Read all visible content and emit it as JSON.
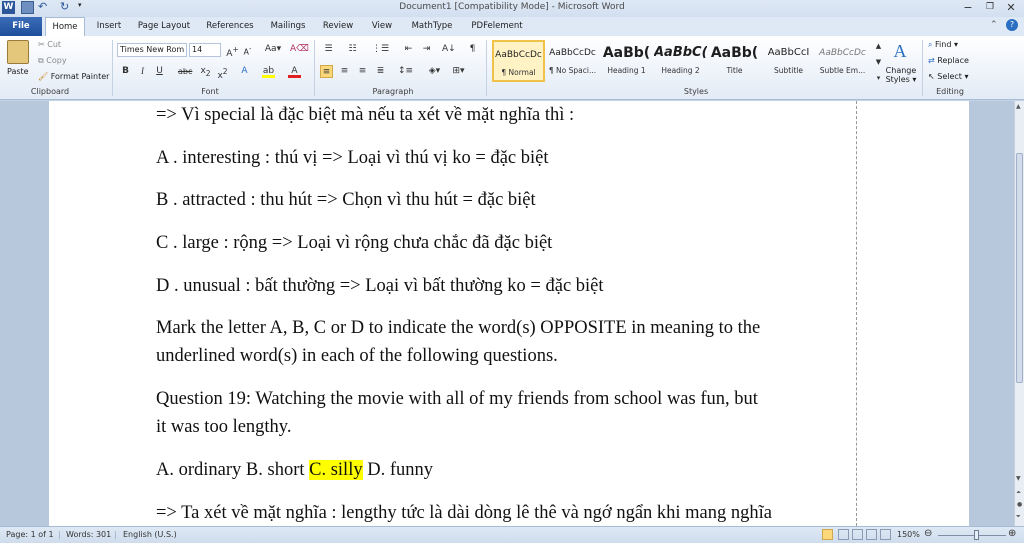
{
  "window": {
    "title": "Document1 [Compatibility Mode] - Microsoft Word",
    "minimize": "−",
    "restore": "❐",
    "close": "✕"
  },
  "tabs": [
    "File",
    "Home",
    "Insert",
    "Page Layout",
    "References",
    "Mailings",
    "Review",
    "View",
    "MathType",
    "PDFelement"
  ],
  "ribbon": {
    "clipboard": {
      "paste": "Paste",
      "cut": "Cut",
      "copy": "Copy",
      "format_painter": "Format Painter",
      "label": "Clipboard"
    },
    "font": {
      "name": "Times New Rom",
      "size": "14",
      "label": "Font"
    },
    "paragraph": {
      "label": "Paragraph"
    },
    "styles": {
      "label": "Styles",
      "items": [
        {
          "preview": "AaBbCcDc",
          "name": "¶ Normal"
        },
        {
          "preview": "AaBbCcDc",
          "name": "¶ No Spaci..."
        },
        {
          "preview": "AaBb(",
          "name": "Heading 1"
        },
        {
          "preview": "AaBbC(",
          "name": "Heading 2"
        },
        {
          "preview": "AaBb(",
          "name": "Title"
        },
        {
          "preview": "AaBbCcI",
          "name": "Subtitle"
        },
        {
          "preview": "AaBbCcDc",
          "name": "Subtle Em..."
        }
      ],
      "change_styles": "Change Styles ▾"
    },
    "editing": {
      "find": "Find ▾",
      "replace": "Replace",
      "select": "Select ▾",
      "label": "Editing"
    }
  },
  "document": {
    "lines": {
      "l1": "=> Vì special là đặc biệt mà nếu ta xét về mặt nghĩa thì :",
      "l2": "A . interesting : thú vị => Loại vì thú vị ko = đặc biệt",
      "l3": "B . attracted : thu hút => Chọn vì thu hút = đặc biệt",
      "l4": "C . large : rộng => Loại vì rộng chưa chắc đã đặc biệt",
      "l5": "D . unusual : bất thường => Loại vì bất thường ko = đặc biệt",
      "l6a": "Mark the letter A, B, C or D to indicate the word(s) OPPOSITE in meaning to the",
      "l6b": "underlined word(s) in each of the following questions.",
      "l7a": "Question 19: Watching the movie with all of my friends from school was fun, but",
      "l7b": "it was too lengthy.",
      "l8_pre": "A. ordinary B. short ",
      "l8_hl": "C. silly",
      "l8_post": " D. funny",
      "l9": "=> Ta xét về mặt nghĩa : lengthy tức là dài dòng lê thê và ngớ ngẩn khi mang nghĩa"
    }
  },
  "status": {
    "page": "Page: 1 of 1",
    "words": "Words: 301",
    "language": "English (U.S.)",
    "zoom": "150%"
  }
}
